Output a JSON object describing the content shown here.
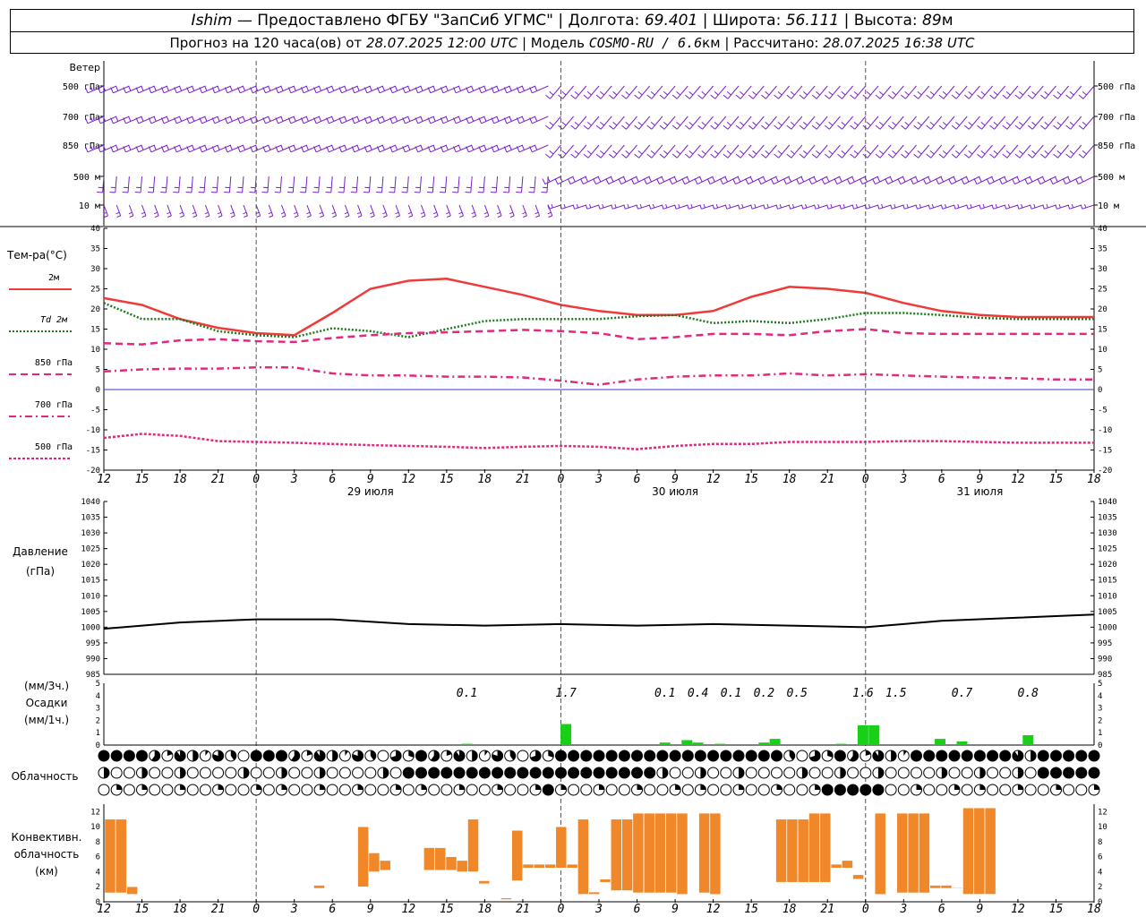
{
  "header": {
    "station": "Ishim",
    "dash": " — ",
    "provider": "Предоставлено ФГБУ \"ЗапСиб УГМС\"",
    "sep": " | ",
    "lon_label": "Долгота: ",
    "lon_value": "69.401",
    "lat_label": "Широта: ",
    "lat_value": "56.111",
    "alt_label": "Высота: ",
    "alt_value": "89",
    "alt_unit": "м",
    "forecast_label": "Прогноз на 120 часа(ов) от ",
    "forecast_start": "28.07.2025 12:00 UTC",
    "model_label": " | Модель ",
    "model_value": "COSMO-RU / 6.6",
    "model_unit": "км",
    "calc_label": " | Рассчитано: ",
    "calc_value": "28.07.2025 16:38 UTC"
  },
  "colors": {
    "wind": "#7b1fd0",
    "t2m": "#f03a3a",
    "td2m": "#1f7a1f",
    "t850": "#e0297f",
    "t700": "#e0297f",
    "t500": "#e0297f",
    "zero_line": "#2c3cd0",
    "pressure": "#000000",
    "precip": "#18d018",
    "convective": "#f0882a"
  },
  "wind_panel": {
    "title": "Ветер",
    "levels": [
      "500 гПа",
      "700 гПа",
      "850 гПа",
      "500 м",
      "10 м"
    ]
  },
  "temp_panel": {
    "title": "Тем-ра(°C)",
    "legend": [
      {
        "label": "2м",
        "style": "solid",
        "color_key": "t2m"
      },
      {
        "label": "Td 2м",
        "style": "dotted",
        "color_key": "td2m"
      },
      {
        "label": "850 гПа",
        "style": "dashed",
        "color_key": "t850"
      },
      {
        "label": "700 гПа",
        "style": "dashdot",
        "color_key": "t700"
      },
      {
        "label": "500 гПа",
        "style": "dotted",
        "color_key": "t500"
      }
    ]
  },
  "pressure_panel": {
    "title": "Давление",
    "unit": "(гПа)"
  },
  "precip_panel": {
    "unit_top": "(мм/3ч.)",
    "title": "Осадки",
    "unit_bottom": "(мм/1ч.)"
  },
  "cloud_panel": {
    "title": "Облачность"
  },
  "conv_panel": {
    "title_lines": [
      "Конвективн.",
      "облачность",
      "(км)"
    ]
  },
  "time_axis": {
    "hour_labels": [
      "12",
      "15",
      "18",
      "21",
      "0",
      "3",
      "6",
      "9",
      "12",
      "15",
      "18",
      "21",
      "0",
      "3",
      "6",
      "9",
      "12",
      "15",
      "18",
      "21",
      "0",
      "3",
      "6",
      "9",
      "12",
      "15",
      "18"
    ],
    "date_labels": [
      "29 июля",
      "30 июля",
      "31 июля"
    ]
  },
  "chart_data": [
    {
      "type": "line",
      "id": "temperature",
      "x_hours_from_start": [
        0,
        3,
        6,
        9,
        12,
        15,
        18,
        21,
        24,
        27,
        30,
        33,
        36,
        39,
        42,
        45,
        48,
        51,
        54,
        57,
        60,
        63,
        66,
        69,
        72,
        75,
        78
      ],
      "ylim": [
        -20,
        40
      ],
      "yticks": [
        -20,
        -15,
        -10,
        -5,
        0,
        5,
        10,
        15,
        20,
        25,
        30,
        35,
        40
      ],
      "series": [
        {
          "name": "2м",
          "values": [
            22.7,
            21,
            17.5,
            15.3,
            14,
            13.5,
            19,
            25,
            27,
            27.5,
            25.5,
            23.5,
            21,
            19.5,
            18.5,
            18.5,
            19.5,
            23,
            25.5,
            25,
            24,
            21.5,
            19.5,
            18.5,
            18,
            18,
            18
          ]
        },
        {
          "name": "Td 2м",
          "values": [
            21.5,
            17.5,
            17.5,
            14.5,
            13.5,
            13,
            15.2,
            14.5,
            13,
            15,
            17,
            17.5,
            17.5,
            17.5,
            18.2,
            18.5,
            16.5,
            17,
            16.5,
            17.5,
            19,
            19,
            18.5,
            17.8,
            17.5,
            17.5,
            17.5
          ]
        },
        {
          "name": "850 гПа",
          "values": [
            11.5,
            11.2,
            12.2,
            12.5,
            12,
            11.8,
            12.8,
            13.5,
            14,
            14.2,
            14.5,
            14.8,
            14.5,
            14,
            12.5,
            13,
            13.8,
            13.8,
            13.5,
            14.5,
            15,
            14,
            13.8,
            13.8,
            13.8,
            13.8,
            13.8
          ]
        },
        {
          "name": "700 гПа",
          "values": [
            4.5,
            5,
            5.2,
            5.2,
            5.5,
            5.5,
            4,
            3.5,
            3.5,
            3.2,
            3.2,
            3,
            2.2,
            1.2,
            2.5,
            3.2,
            3.5,
            3.5,
            4,
            3.5,
            3.8,
            3.5,
            3.2,
            3,
            2.8,
            2.5,
            2.5
          ]
        },
        {
          "name": "500 гПа",
          "values": [
            -12,
            -11,
            -11.5,
            -12.8,
            -13,
            -13.2,
            -13.5,
            -13.8,
            -14,
            -14.2,
            -14.5,
            -14.2,
            -14,
            -14.2,
            -14.8,
            -14,
            -13.5,
            -13.5,
            -13,
            -13,
            -13,
            -12.8,
            -12.8,
            -13,
            -13.2,
            -13.2,
            -13.2
          ]
        }
      ]
    },
    {
      "type": "line",
      "id": "pressure",
      "x_hours_from_start": [
        0,
        6,
        12,
        18,
        24,
        30,
        36,
        42,
        48,
        54,
        60,
        66,
        72,
        78
      ],
      "ylim": [
        985,
        1040
      ],
      "yticks": [
        985,
        990,
        995,
        1000,
        1005,
        1010,
        1015,
        1020,
        1025,
        1030,
        1035,
        1040
      ],
      "series": [
        {
          "name": "Давление",
          "values": [
            999.5,
            1001.5,
            1002.5,
            1002.5,
            1001,
            1000.5,
            1001,
            1000.5,
            1001,
            1000.5,
            1000,
            1002,
            1003,
            1004
          ]
        }
      ]
    },
    {
      "type": "bar",
      "id": "precipitation",
      "ylim": [
        0,
        5
      ],
      "yticks": [
        0,
        1,
        2,
        3,
        4,
        5
      ],
      "totals_3h": [
        {
          "hour": 33,
          "label": "0.1"
        },
        {
          "hour": 42,
          "label": "1.7"
        },
        {
          "hour": 51,
          "label": "0.1"
        },
        {
          "hour": 54,
          "label": "0.4"
        },
        {
          "hour": 57,
          "label": "0.1"
        },
        {
          "hour": 60,
          "label": "0.2"
        },
        {
          "hour": 63,
          "label": "0.5"
        },
        {
          "hour": 69,
          "label": "1.6"
        },
        {
          "hour": 72,
          "label": "1.5"
        },
        {
          "hour": 78,
          "label": "0.7"
        },
        {
          "hour": 84,
          "label": "0.8"
        }
      ],
      "hourly": [
        {
          "hour": 33,
          "value": 0.1
        },
        {
          "hour": 42,
          "value": 1.7
        },
        {
          "hour": 51,
          "value": 0.2
        },
        {
          "hour": 53,
          "value": 0.4
        },
        {
          "hour": 54,
          "value": 0.2
        },
        {
          "hour": 56,
          "value": 0.1
        },
        {
          "hour": 60,
          "value": 0.2
        },
        {
          "hour": 61,
          "value": 0.5
        },
        {
          "hour": 67,
          "value": 0.1
        },
        {
          "hour": 69,
          "value": 1.6
        },
        {
          "hour": 70,
          "value": 1.6
        },
        {
          "hour": 76,
          "value": 0.5
        },
        {
          "hour": 78,
          "value": 0.3
        },
        {
          "hour": 84,
          "value": 0.8
        }
      ]
    },
    {
      "type": "bar",
      "id": "convective_cloud",
      "ylim": [
        0,
        13
      ],
      "yticks": [
        0,
        2,
        4,
        6,
        8,
        10,
        12
      ],
      "bars": [
        {
          "hour": 0,
          "base": 1.2,
          "top": 11
        },
        {
          "hour": 1,
          "base": 1.2,
          "top": 11
        },
        {
          "hour": 2,
          "base": 1.0,
          "top": 2
        },
        {
          "hour": 19,
          "base": 1.8,
          "top": 2.2
        },
        {
          "hour": 23,
          "base": 2.0,
          "top": 10
        },
        {
          "hour": 24,
          "base": 4.0,
          "top": 6.5
        },
        {
          "hour": 25,
          "base": 4.2,
          "top": 5.5
        },
        {
          "hour": 29,
          "base": 4.2,
          "top": 7.2
        },
        {
          "hour": 30,
          "base": 4.2,
          "top": 7.2
        },
        {
          "hour": 31,
          "base": 4.2,
          "top": 6
        },
        {
          "hour": 32,
          "base": 4.0,
          "top": 5.5
        },
        {
          "hour": 33,
          "base": 4.0,
          "top": 11
        },
        {
          "hour": 34,
          "base": 2.4,
          "top": 2.8
        },
        {
          "hour": 36,
          "base": 0.3,
          "top": 0.5
        },
        {
          "hour": 37,
          "base": 2.8,
          "top": 9.5
        },
        {
          "hour": 38,
          "base": 4.5,
          "top": 5
        },
        {
          "hour": 39,
          "base": 4.5,
          "top": 5
        },
        {
          "hour": 40,
          "base": 4.5,
          "top": 5
        },
        {
          "hour": 41,
          "base": 4.5,
          "top": 10
        },
        {
          "hour": 42,
          "base": 4.5,
          "top": 5
        },
        {
          "hour": 43,
          "base": 1.0,
          "top": 11
        },
        {
          "hour": 44,
          "base": 1.0,
          "top": 1.3
        },
        {
          "hour": 45,
          "base": 2.6,
          "top": 3
        },
        {
          "hour": 46,
          "base": 1.5,
          "top": 11
        },
        {
          "hour": 47,
          "base": 1.5,
          "top": 11
        },
        {
          "hour": 48,
          "base": 1.2,
          "top": 11.8
        },
        {
          "hour": 49,
          "base": 1.2,
          "top": 11.8
        },
        {
          "hour": 50,
          "base": 1.2,
          "top": 11.8
        },
        {
          "hour": 51,
          "base": 1.2,
          "top": 11.8
        },
        {
          "hour": 52,
          "base": 1.0,
          "top": 11.8
        },
        {
          "hour": 54,
          "base": 1.2,
          "top": 11.8
        },
        {
          "hour": 55,
          "base": 1.0,
          "top": 11.8
        },
        {
          "hour": 61,
          "base": 2.6,
          "top": 11
        },
        {
          "hour": 62,
          "base": 2.6,
          "top": 11
        },
        {
          "hour": 63,
          "base": 2.6,
          "top": 11
        },
        {
          "hour": 64,
          "base": 2.6,
          "top": 11.8
        },
        {
          "hour": 65,
          "base": 2.6,
          "top": 11.8
        },
        {
          "hour": 66,
          "base": 4.5,
          "top": 5
        },
        {
          "hour": 67,
          "base": 4.5,
          "top": 5.5
        },
        {
          "hour": 68,
          "base": 3.0,
          "top": 3.6
        },
        {
          "hour": 70,
          "base": 1.0,
          "top": 11.8
        },
        {
          "hour": 72,
          "base": 1.2,
          "top": 11.8
        },
        {
          "hour": 73,
          "base": 1.2,
          "top": 11.8
        },
        {
          "hour": 74,
          "base": 1.2,
          "top": 11.8
        },
        {
          "hour": 75,
          "base": 1.8,
          "top": 2.2
        },
        {
          "hour": 76,
          "base": 1.8,
          "top": 2.2
        },
        {
          "hour": 77,
          "base": 1.8,
          "top": 1.9
        },
        {
          "hour": 78,
          "base": 1.0,
          "top": 12.5
        },
        {
          "hour": 79,
          "base": 1.0,
          "top": 12.5
        },
        {
          "hour": 80,
          "base": 1.0,
          "top": 12.5
        }
      ]
    }
  ]
}
